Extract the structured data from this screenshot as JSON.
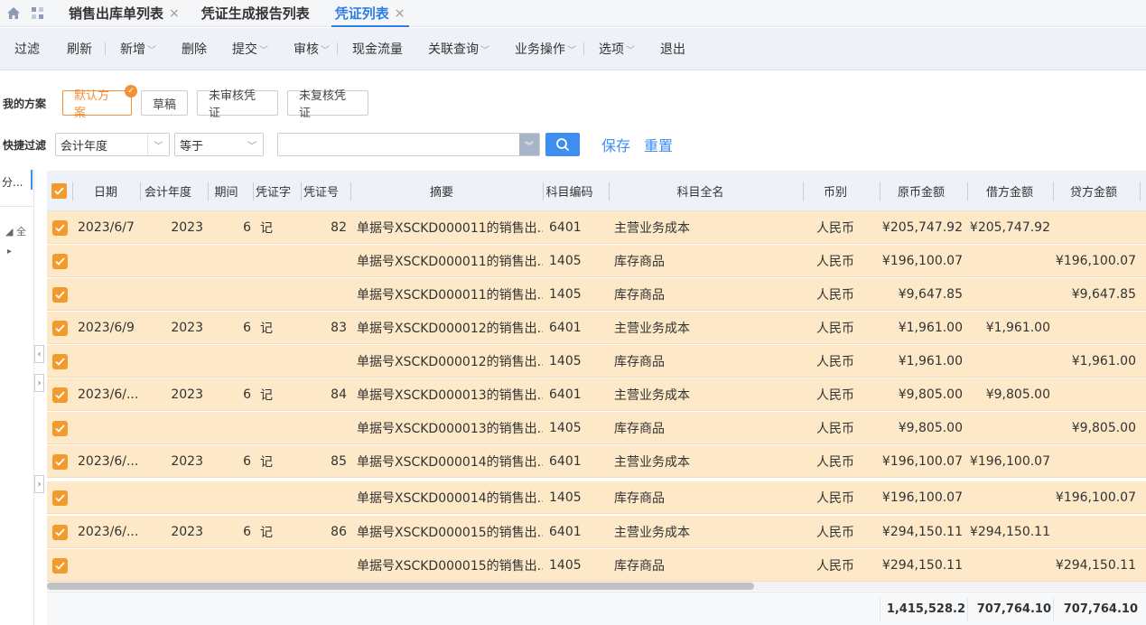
{
  "tabs": [
    {
      "label": "销售出库单列表",
      "closable": true
    },
    {
      "label": "凭证生成报告列表",
      "closable": false
    },
    {
      "label": "凭证列表",
      "closable": true,
      "active": true
    }
  ],
  "toolbar": {
    "filter": "过滤",
    "refresh": "刷新",
    "add": "新增",
    "delete": "删除",
    "submit": "提交",
    "audit": "审核",
    "cashflow": "现金流量",
    "related": "关联查询",
    "business": "业务操作",
    "options": "选项",
    "exit": "退出"
  },
  "scheme": {
    "label": "我的方案",
    "items": [
      "默认方案",
      "草稿",
      "未审核凭证",
      "未复核凭证"
    ],
    "active_index": 0
  },
  "quick_filter": {
    "label": "快捷过滤",
    "field": "会计年度",
    "operator": "等于",
    "value": "",
    "save": "保存",
    "reset": "重置"
  },
  "left_panel": {
    "title": "分...",
    "tree_root": "全"
  },
  "columns": [
    "日期",
    "会计年度",
    "期间",
    "凭证字",
    "凭证号",
    "摘要",
    "科目编码",
    "科目全名",
    "币别",
    "原币金额",
    "借方金额",
    "贷方金额"
  ],
  "rows": [
    {
      "date": "2023/6/7",
      "year": "2023",
      "period": "6",
      "word": "记",
      "no": "82",
      "summary": "单据号XSCKD000011的销售出...",
      "code": "6401",
      "account": "主营业务成本",
      "currency": "人民币",
      "amount": "¥205,747.92",
      "debit": "¥205,747.92",
      "credit": ""
    },
    {
      "date": "",
      "year": "",
      "period": "",
      "word": "",
      "no": "",
      "summary": "单据号XSCKD000011的销售出...",
      "code": "1405",
      "account": "库存商品",
      "currency": "人民币",
      "amount": "¥196,100.07",
      "debit": "",
      "credit": "¥196,100.07"
    },
    {
      "date": "",
      "year": "",
      "period": "",
      "word": "",
      "no": "",
      "summary": "单据号XSCKD000011的销售出...",
      "code": "1405",
      "account": "库存商品",
      "currency": "人民币",
      "amount": "¥9,647.85",
      "debit": "",
      "credit": "¥9,647.85"
    },
    {
      "date": "2023/6/9",
      "year": "2023",
      "period": "6",
      "word": "记",
      "no": "83",
      "summary": "单据号XSCKD000012的销售出...",
      "code": "6401",
      "account": "主营业务成本",
      "currency": "人民币",
      "amount": "¥1,961.00",
      "debit": "¥1,961.00",
      "credit": ""
    },
    {
      "date": "",
      "year": "",
      "period": "",
      "word": "",
      "no": "",
      "summary": "单据号XSCKD000012的销售出...",
      "code": "1405",
      "account": "库存商品",
      "currency": "人民币",
      "amount": "¥1,961.00",
      "debit": "",
      "credit": "¥1,961.00"
    },
    {
      "date": "2023/6/...",
      "year": "2023",
      "period": "6",
      "word": "记",
      "no": "84",
      "summary": "单据号XSCKD000013的销售出...",
      "code": "6401",
      "account": "主营业务成本",
      "currency": "人民币",
      "amount": "¥9,805.00",
      "debit": "¥9,805.00",
      "credit": ""
    },
    {
      "date": "",
      "year": "",
      "period": "",
      "word": "",
      "no": "",
      "summary": "单据号XSCKD000013的销售出...",
      "code": "1405",
      "account": "库存商品",
      "currency": "人民币",
      "amount": "¥9,805.00",
      "debit": "",
      "credit": "¥9,805.00"
    },
    {
      "date": "2023/6/...",
      "year": "2023",
      "period": "6",
      "word": "记",
      "no": "85",
      "summary": "单据号XSCKD000014的销售出...",
      "code": "6401",
      "account": "主营业务成本",
      "currency": "人民币",
      "amount": "¥196,100.07",
      "debit": "¥196,100.07",
      "credit": ""
    },
    {
      "date": "",
      "year": "",
      "period": "",
      "word": "",
      "no": "",
      "summary": "单据号XSCKD000014的销售出...",
      "code": "1405",
      "account": "库存商品",
      "currency": "人民币",
      "amount": "¥196,100.07",
      "debit": "",
      "credit": "¥196,100.07"
    },
    {
      "date": "2023/6/...",
      "year": "2023",
      "period": "6",
      "word": "记",
      "no": "86",
      "summary": "单据号XSCKD000015的销售出...",
      "code": "6401",
      "account": "主营业务成本",
      "currency": "人民币",
      "amount": "¥294,150.11",
      "debit": "¥294,150.11",
      "credit": ""
    },
    {
      "date": "",
      "year": "",
      "period": "",
      "word": "",
      "no": "",
      "summary": "单据号XSCKD000015的销售出...",
      "code": "1405",
      "account": "库存商品",
      "currency": "人民币",
      "amount": "¥294,150.11",
      "debit": "",
      "credit": "¥294,150.11"
    }
  ],
  "totals": {
    "amount": "1,415,528.2",
    "debit": "707,764.10",
    "credit": "707,764.10"
  },
  "colors": {
    "accent": "#3e8ef0",
    "selected_row": "#fde8c7",
    "checkbox": "#f39a2c",
    "active_chip": "#f0913a"
  }
}
